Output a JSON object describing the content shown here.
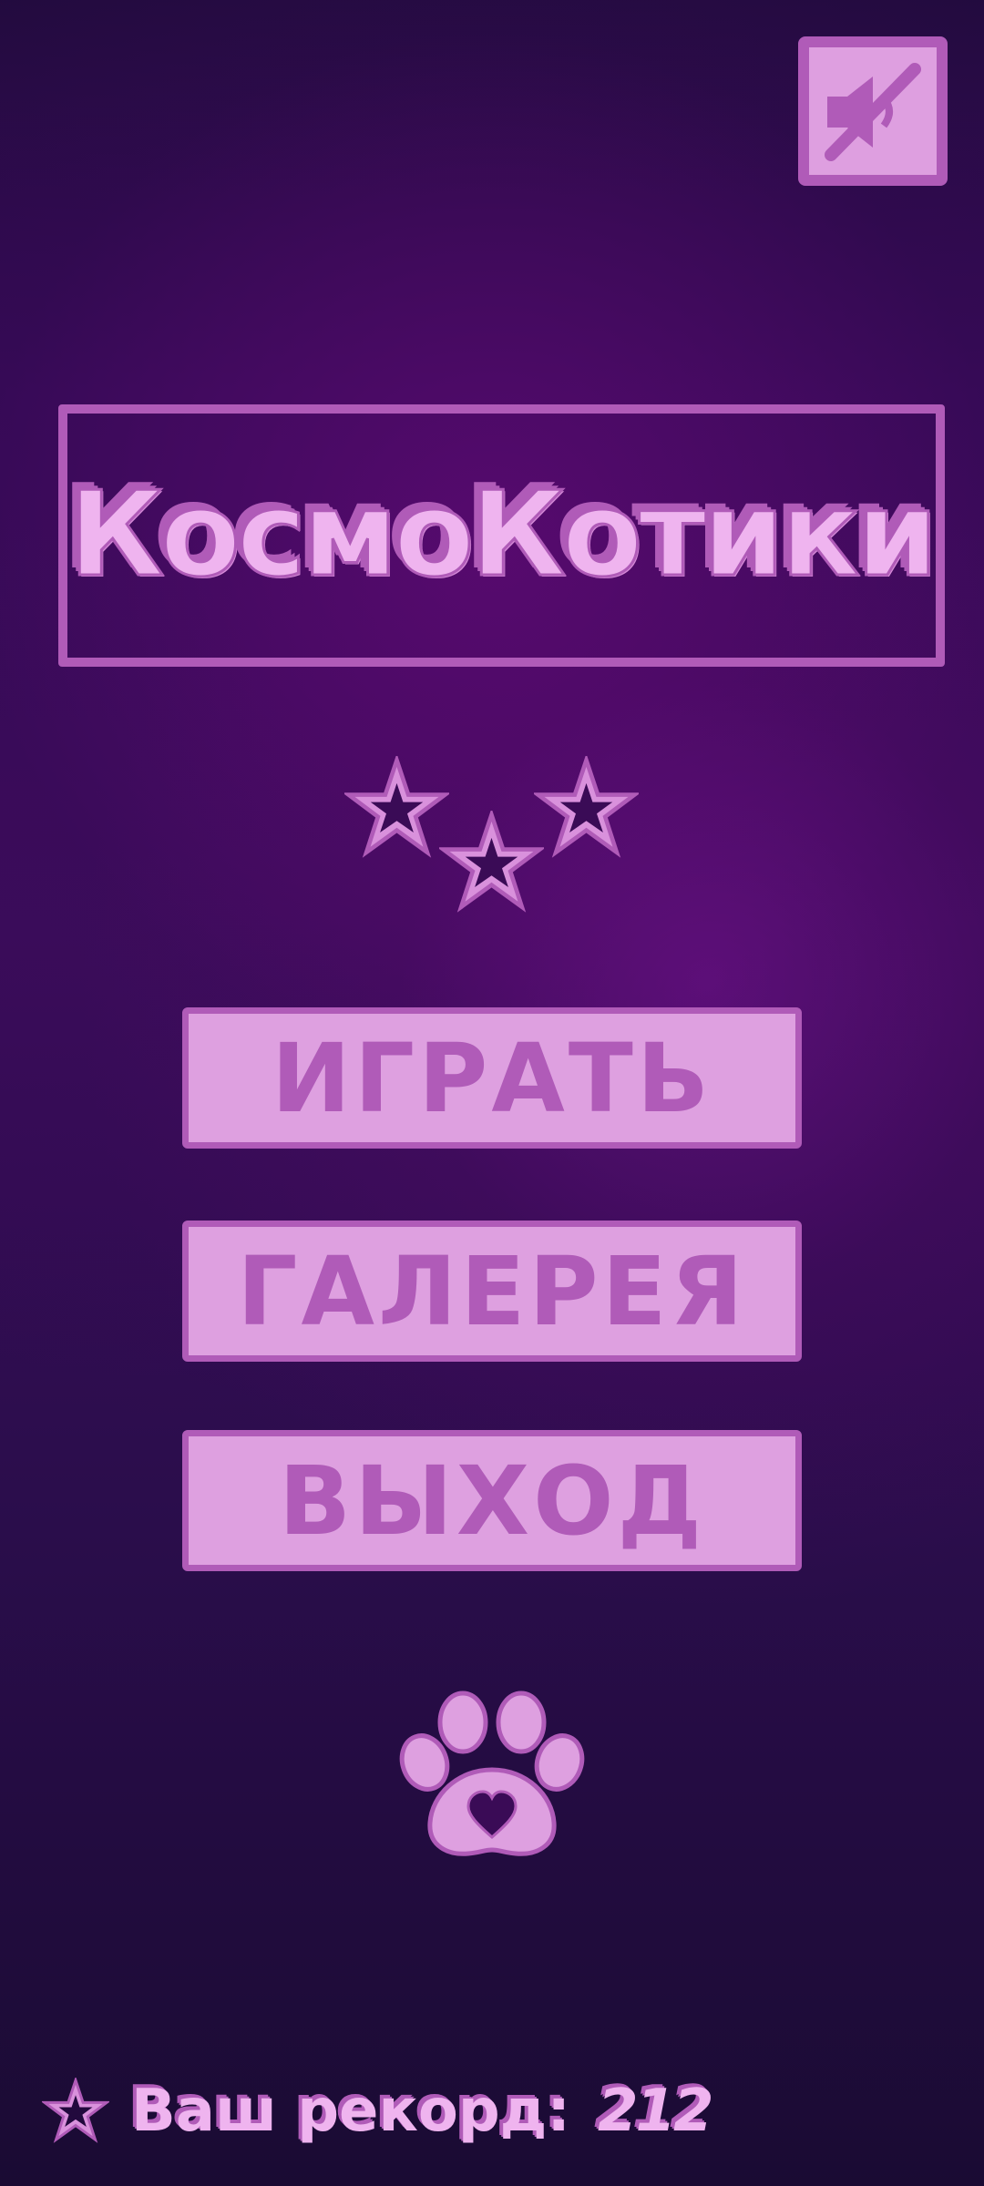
{
  "header": {
    "mute_button_icon": "speaker-muted-icon"
  },
  "title": {
    "text": "КосмоКотики"
  },
  "rating": {
    "stars_icon": "star-outline-icon",
    "count": 3
  },
  "menu": {
    "play_label": "ИГРАТЬ",
    "gallery_label": "ГАЛЕРЕЯ",
    "exit_label": "ВЫХОД"
  },
  "decoration": {
    "paw_icon": "paw-heart-icon"
  },
  "record": {
    "icon": "star-outline-icon",
    "label": "Ваш рекорд:",
    "value": "212"
  },
  "colors": {
    "background_top": "#1e0b3a",
    "background_mid": "#3a0c5a",
    "accent_light": "#dea0e0",
    "accent_dark": "#b05bb8",
    "title_fill": "#efb4ef"
  }
}
